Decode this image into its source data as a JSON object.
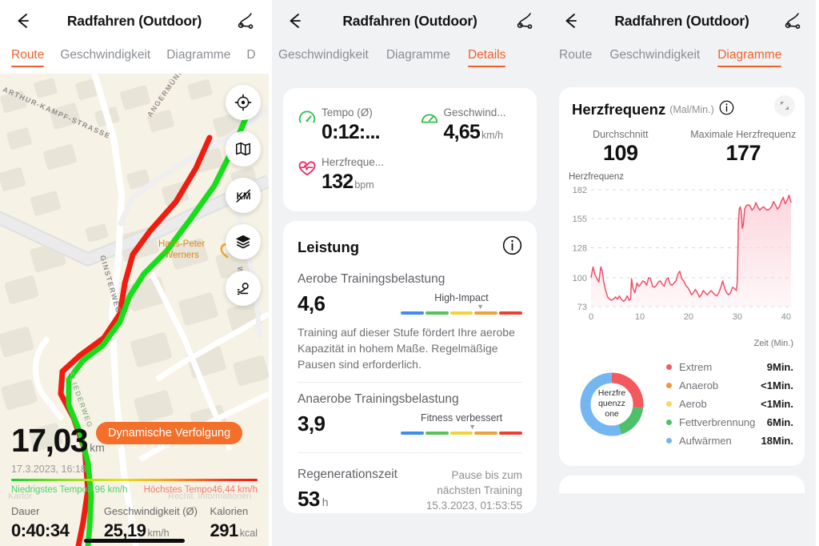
{
  "app": {
    "title": "Radfahren (Outdoor)",
    "back_icon": "arrow-left-icon",
    "share_icon": "share-route-icon"
  },
  "panel1": {
    "tabs": [
      {
        "label": "Route",
        "active": true
      },
      {
        "label": "Geschwindigkeit",
        "active": false
      },
      {
        "label": "Diagramme",
        "active": false
      },
      {
        "label": "D",
        "active": false
      }
    ],
    "map": {
      "street_labels": [
        "ARTHUR-KAMPF-STRASSE",
        "ANGERMÜNDER",
        "GINSTERWEG",
        "FLIEDERWEG",
        "WEG"
      ],
      "poi": "Hans-Peter\nWerners",
      "poi_line1": "Hans-Peter",
      "poi_line2": "Werners",
      "buttons": [
        {
          "name": "locate-icon"
        },
        {
          "name": "map-type-icon"
        },
        {
          "name": "no-km-markers-icon"
        },
        {
          "name": "layers-icon"
        },
        {
          "name": "place-pin-icon"
        }
      ],
      "watermark_left": "Kartor",
      "watermark_right": "Rechtl. Informationen"
    },
    "summary": {
      "distance": "17,03",
      "distance_unit": "km",
      "chip": "Dynamische Verfolgung",
      "timestamp": "17.3.2023, 16:18",
      "tempo_low": "Niedrigstes Tempo3,96 km/h",
      "tempo_high": "Höchstes Tempo46,44 km/h",
      "stats": [
        {
          "label": "Dauer",
          "value": "0:40:34",
          "unit": ""
        },
        {
          "label": "Geschwindigkeit (Ø)",
          "value": "25,19",
          "unit": "km/h"
        },
        {
          "label": "Kalorien",
          "value": "291",
          "unit": "kcal"
        }
      ]
    }
  },
  "panel2": {
    "tabs": [
      {
        "label": "Geschwindigkeit",
        "active": false
      },
      {
        "label": "Diagramme",
        "active": false
      },
      {
        "label": "Details",
        "active": true
      }
    ],
    "metrics": [
      {
        "icon": "pace-gauge-icon",
        "label": "Tempo (Ø)",
        "value": "0:12:...",
        "unit": ""
      },
      {
        "icon": "speed-gauge-icon",
        "label": "Geschwind...",
        "value": "4,65",
        "unit": "km/h"
      },
      {
        "icon": "heart-rate-icon",
        "label": "Herzfreque...",
        "value": "132",
        "unit": "bpm"
      }
    ],
    "leistung": {
      "title": "Leistung",
      "info_icon": "info-icon",
      "aerobic": {
        "label": "Aerobe Trainingsbelastung",
        "value": "4,6",
        "caption": "High-Impact",
        "marker_position": 62,
        "description": "Training auf dieser Stufe fördert Ihre aerobe Kapazität in hohem Maße. Regelmäßige Pausen sind erforderlich."
      },
      "anaerobic": {
        "label": "Anaerobe Trainingsbelastung",
        "value": "3,9",
        "caption": "Fitness verbessert",
        "marker_position": 56
      },
      "regeneration": {
        "label": "Regenerationszeit",
        "value": "53",
        "unit": "h",
        "note_line1": "Pause bis zum",
        "note_line2": "nächsten Training",
        "note_line3": "15.3.2023, 01:53:55"
      },
      "scale_colors": [
        "#3d8ee8",
        "#56c25a",
        "#f2d33f",
        "#f0a03a",
        "#ec4030"
      ]
    }
  },
  "panel3": {
    "tabs": [
      {
        "label": "Route",
        "active": false
      },
      {
        "label": "Geschwindigkeit",
        "active": false
      },
      {
        "label": "Diagramme",
        "active": true
      }
    ],
    "heart_card": {
      "title": "Herzfrequenz",
      "subtitle": "(Mal/Min.)",
      "info_icon": "info-icon",
      "expand_icon": "expand-icon",
      "avg_label": "Durchschnitt",
      "avg_value": "109",
      "max_label": "Maximale Herzfrequenz",
      "max_value": "177"
    },
    "zones": {
      "donut_caption_lines": [
        "Herzfre",
        "quenzz",
        "one"
      ],
      "legend": [
        {
          "name": "Extrem",
          "value": "9Min.",
          "color": "#f4595e"
        },
        {
          "name": "Anaerob",
          "value": "<1Min.",
          "color": "#f1973a"
        },
        {
          "name": "Aerob",
          "value": "<1Min.",
          "color": "#f5d868"
        },
        {
          "name": "Fettverbrennung",
          "value": "6Min.",
          "color": "#4cc06a"
        },
        {
          "name": "Aufwärmen",
          "value": "18Min.",
          "color": "#74b6f0"
        }
      ],
      "donut_segments": [
        {
          "name": "Extrem",
          "color": "#f4595e",
          "fraction": 0.27
        },
        {
          "name": "Fettverbrennung",
          "color": "#4cc06a",
          "fraction": 0.18
        },
        {
          "name": "Aufwärmen",
          "color": "#74b6f0",
          "fraction": 0.55
        }
      ]
    }
  },
  "chart_data": {
    "type": "area",
    "title": "Herzfrequenz",
    "ylabel": "Herzfrequenz",
    "xlabel": "Zeit (Min.)",
    "yticks": [
      73,
      100,
      128,
      155,
      182
    ],
    "xticks": [
      0,
      10,
      20,
      30,
      40
    ],
    "ylim": [
      73,
      182
    ],
    "xlim": [
      0,
      41
    ],
    "grid": true,
    "legend_position": "none",
    "line_color": "#ef4e68",
    "fill_color": "#fbd4dc",
    "series": [
      {
        "name": "Herzfrequenz",
        "x": [
          0,
          0.4,
          0.8,
          1.2,
          1.6,
          2.0,
          2.3,
          2.6,
          3.0,
          3.4,
          3.8,
          4.2,
          4.6,
          5.0,
          5.4,
          5.8,
          6.2,
          6.6,
          7.0,
          7.4,
          7.8,
          8.1,
          8.3,
          8.6,
          9.0,
          9.4,
          9.8,
          10.2,
          10.6,
          11.0,
          11.4,
          11.8,
          12.2,
          12.6,
          13.0,
          13.4,
          13.8,
          14.2,
          14.6,
          15.0,
          15.4,
          15.8,
          16.2,
          16.6,
          17.0,
          17.4,
          17.8,
          18.2,
          18.6,
          19.0,
          19.4,
          19.8,
          20.2,
          20.6,
          21.0,
          21.4,
          21.8,
          22.2,
          22.6,
          23.0,
          23.4,
          23.8,
          24.2,
          24.6,
          25.0,
          25.4,
          25.8,
          26.2,
          26.6,
          27.0,
          27.4,
          27.8,
          28.2,
          28.6,
          29.0,
          29.4,
          29.8,
          30.0,
          30.2,
          30.4,
          30.6,
          30.8,
          31.0,
          31.2,
          31.5,
          31.8,
          32.2,
          32.6,
          33.0,
          33.4,
          33.8,
          34.2,
          34.6,
          35.0,
          35.4,
          35.8,
          36.2,
          36.6,
          37.0,
          37.4,
          37.8,
          38.2,
          38.6,
          39.0,
          39.4,
          39.8,
          40.2,
          40.6,
          41.0
        ],
        "y": [
          100,
          110,
          103,
          99,
          96,
          110,
          106,
          96,
          88,
          82,
          80,
          79,
          80,
          82,
          80,
          83,
          80,
          78,
          79,
          83,
          79,
          80,
          99,
          90,
          86,
          95,
          92,
          94,
          97,
          96,
          93,
          100,
          99,
          92,
          91,
          93,
          96,
          97,
          94,
          92,
          98,
          100,
          94,
          93,
          95,
          97,
          103,
          106,
          99,
          97,
          93,
          91,
          88,
          84,
          86,
          89,
          86,
          82,
          84,
          88,
          86,
          84,
          86,
          88,
          86,
          84,
          83,
          86,
          91,
          97,
          90,
          86,
          84,
          86,
          91,
          90,
          88,
          97,
          150,
          164,
          166,
          162,
          146,
          149,
          164,
          167,
          168,
          167,
          163,
          165,
          170,
          166,
          163,
          165,
          166,
          164,
          163,
          164,
          166,
          171,
          168,
          164,
          166,
          171,
          175,
          169,
          172,
          177,
          170
        ]
      }
    ]
  }
}
